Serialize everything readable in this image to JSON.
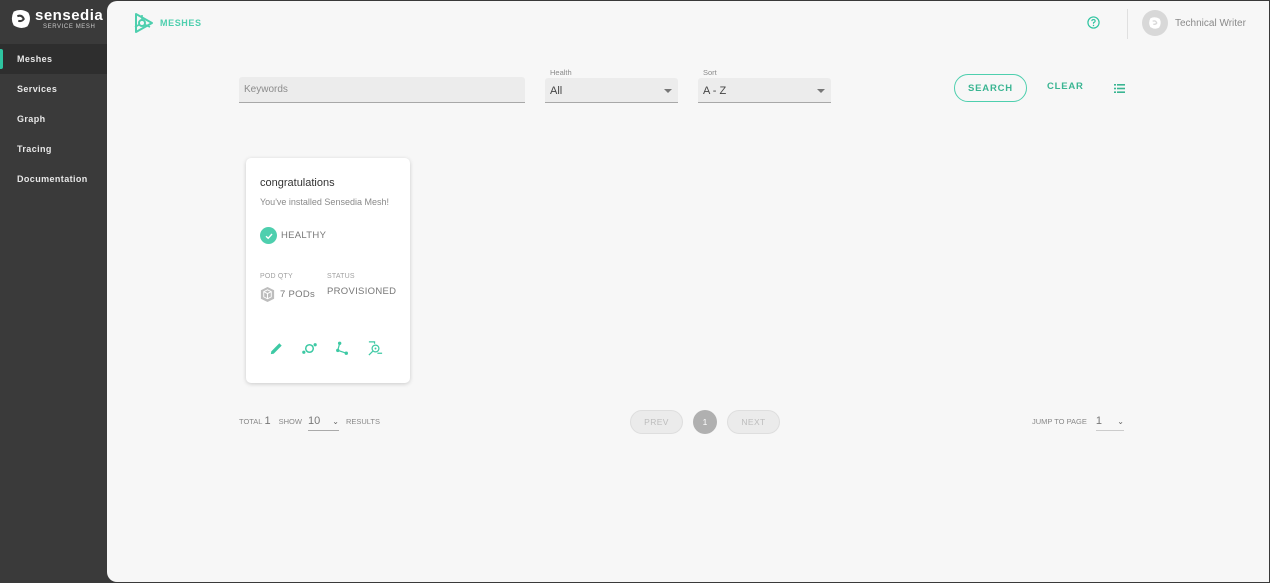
{
  "brand": {
    "name": "sensedia",
    "subtitle": "SERVICE MESH"
  },
  "sidebar": {
    "items": [
      {
        "label": "Meshes",
        "active": true
      },
      {
        "label": "Services"
      },
      {
        "label": "Graph"
      },
      {
        "label": "Tracing"
      },
      {
        "label": "Documentation"
      }
    ]
  },
  "header": {
    "title": "MESHES",
    "user_name": "Technical Writer",
    "help_icon": "help-circle-icon"
  },
  "filters": {
    "keywords_placeholder": "Keywords",
    "keywords_value": "",
    "health_label": "Health",
    "health_value": "All",
    "sort_label": "Sort",
    "sort_value": "A - Z",
    "search_label": "SEARCH",
    "clear_label": "CLEAR"
  },
  "meshes": [
    {
      "name": "congratulations",
      "description": "You've installed Sensedia Mesh!",
      "health": "HEALTHY",
      "pod_qty_label": "POD QTY",
      "pod_qty": "7 PODs",
      "status_label": "STATUS",
      "status": "PROVISIONED"
    }
  ],
  "pagination": {
    "total_label": "TOTAL",
    "total": "1",
    "show_label": "SHOW",
    "show_value": "10",
    "results_label": "RESULTS",
    "prev_label": "PREV",
    "current_page": "1",
    "next_label": "NEXT",
    "jump_label": "JUMP TO PAGE",
    "jump_value": "1"
  },
  "colors": {
    "accent": "#4ecfae",
    "sidebar": "#3a3a3a",
    "background": "#f7f7f7"
  }
}
